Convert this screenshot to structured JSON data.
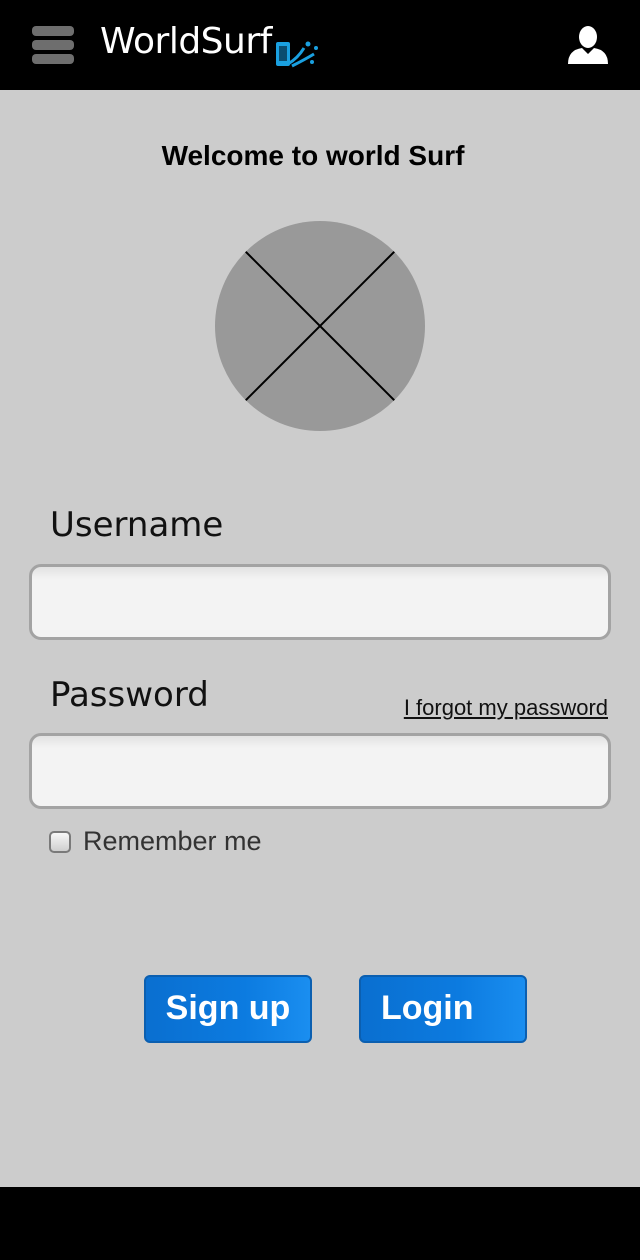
{
  "header": {
    "brand": "WorldSurf",
    "menu_icon": "hamburger-menu-icon",
    "logo_icon": "phone-splash-logo",
    "user_icon": "user-icon",
    "brand_accent": "#1aa0e0"
  },
  "main": {
    "welcome": "Welcome to world Surf",
    "image_placeholder": "image-placeholder"
  },
  "form": {
    "username_label": "Username",
    "username_value": "",
    "password_label": "Password",
    "password_value": "",
    "forgot_link": "I forgot my password",
    "remember_label": "Remember me",
    "remember_checked": false
  },
  "actions": {
    "signup_label": "Sign up",
    "login_label": "Login",
    "button_color": "#0c7be0"
  }
}
